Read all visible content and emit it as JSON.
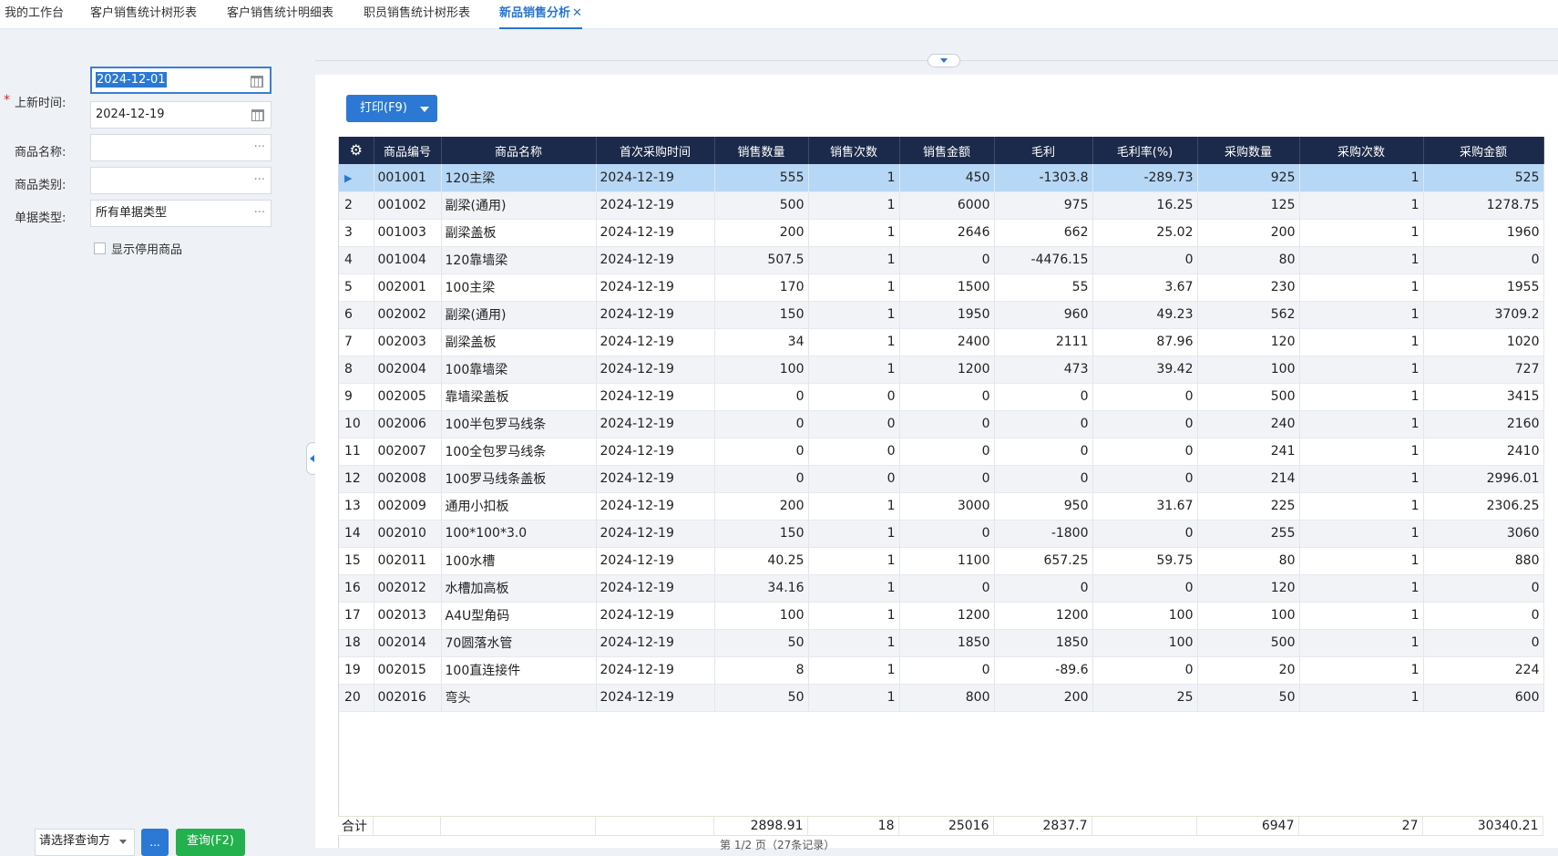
{
  "tabs": [
    {
      "label": "我的工作台"
    },
    {
      "label": "客户销售统计树形表"
    },
    {
      "label": "客户销售统计明细表"
    },
    {
      "label": "职员销售统计树形表"
    },
    {
      "label": "新品销售分析",
      "close": "✕"
    }
  ],
  "filter": {
    "date_label": "上新时间:",
    "date_required": "*",
    "date_from": "2024-12-01",
    "date_to": "2024-12-19",
    "product_name_label": "商品名称:",
    "product_name_value": "",
    "product_category_label": "商品类别:",
    "product_category_value": "",
    "doc_type_label": "单据类型:",
    "doc_type_value": "所有单据类型",
    "show_disabled_label": "显示停用商品",
    "more_glyph": "···",
    "scheme_placeholder": "请选择查询方",
    "scheme_more_label": "...",
    "query_button": "查询(F2)"
  },
  "toolbar": {
    "print_label": "打印(F9)"
  },
  "grid": {
    "columns": [
      "商品编号",
      "商品名称",
      "首次采购时间",
      "销售数量",
      "销售次数",
      "销售金额",
      "毛利",
      "毛利率(%)",
      "采购数量",
      "采购次数",
      "采购金额"
    ],
    "rows": [
      [
        "001001",
        "120主梁",
        "2024-12-19",
        "555",
        "1",
        "450",
        "-1303.8",
        "-289.73",
        "925",
        "1",
        "525"
      ],
      [
        "001002",
        "副梁(通用)",
        "2024-12-19",
        "500",
        "1",
        "6000",
        "975",
        "16.25",
        "125",
        "1",
        "1278.75"
      ],
      [
        "001003",
        "副梁盖板",
        "2024-12-19",
        "200",
        "1",
        "2646",
        "662",
        "25.02",
        "200",
        "1",
        "1960"
      ],
      [
        "001004",
        "120靠墙梁",
        "2024-12-19",
        "507.5",
        "1",
        "0",
        "-4476.15",
        "0",
        "80",
        "1",
        "0"
      ],
      [
        "002001",
        "100主梁",
        "2024-12-19",
        "170",
        "1",
        "1500",
        "55",
        "3.67",
        "230",
        "1",
        "1955"
      ],
      [
        "002002",
        "副梁(通用)",
        "2024-12-19",
        "150",
        "1",
        "1950",
        "960",
        "49.23",
        "562",
        "1",
        "3709.2"
      ],
      [
        "002003",
        "副梁盖板",
        "2024-12-19",
        "34",
        "1",
        "2400",
        "2111",
        "87.96",
        "120",
        "1",
        "1020"
      ],
      [
        "002004",
        "100靠墙梁",
        "2024-12-19",
        "100",
        "1",
        "1200",
        "473",
        "39.42",
        "100",
        "1",
        "727"
      ],
      [
        "002005",
        "靠墙梁盖板",
        "2024-12-19",
        "0",
        "0",
        "0",
        "0",
        "0",
        "500",
        "1",
        "3415"
      ],
      [
        "002006",
        "100半包罗马线条",
        "2024-12-19",
        "0",
        "0",
        "0",
        "0",
        "0",
        "240",
        "1",
        "2160"
      ],
      [
        "002007",
        "100全包罗马线条",
        "2024-12-19",
        "0",
        "0",
        "0",
        "0",
        "0",
        "241",
        "1",
        "2410"
      ],
      [
        "002008",
        "100罗马线条盖板",
        "2024-12-19",
        "0",
        "0",
        "0",
        "0",
        "0",
        "214",
        "1",
        "2996.01"
      ],
      [
        "002009",
        "通用小扣板",
        "2024-12-19",
        "200",
        "1",
        "3000",
        "950",
        "31.67",
        "225",
        "1",
        "2306.25"
      ],
      [
        "002010",
        "100*100*3.0",
        "2024-12-19",
        "150",
        "1",
        "0",
        "-1800",
        "0",
        "255",
        "1",
        "3060"
      ],
      [
        "002011",
        "100水槽",
        "2024-12-19",
        "40.25",
        "1",
        "1100",
        "657.25",
        "59.75",
        "80",
        "1",
        "880"
      ],
      [
        "002012",
        "水槽加高板",
        "2024-12-19",
        "34.16",
        "1",
        "0",
        "0",
        "0",
        "120",
        "1",
        "0"
      ],
      [
        "002013",
        "A4U型角码",
        "2024-12-19",
        "100",
        "1",
        "1200",
        "1200",
        "100",
        "100",
        "1",
        "0"
      ],
      [
        "002014",
        "70圆落水管",
        "2024-12-19",
        "50",
        "1",
        "1850",
        "1850",
        "100",
        "500",
        "1",
        "0"
      ],
      [
        "002015",
        "100直连接件",
        "2024-12-19",
        "8",
        "1",
        "0",
        "-89.6",
        "0",
        "20",
        "1",
        "224"
      ],
      [
        "002016",
        "弯头",
        "2024-12-19",
        "50",
        "1",
        "800",
        "200",
        "25",
        "50",
        "1",
        "600"
      ]
    ],
    "selected_row": 0,
    "total_label": "合计",
    "totals": [
      "",
      "",
      "",
      "2898.91",
      "18",
      "25016",
      "2837.7",
      "",
      "6947",
      "27",
      "30340.21"
    ]
  },
  "pager": {
    "text": "第 1/2 页（27条记录）"
  }
}
